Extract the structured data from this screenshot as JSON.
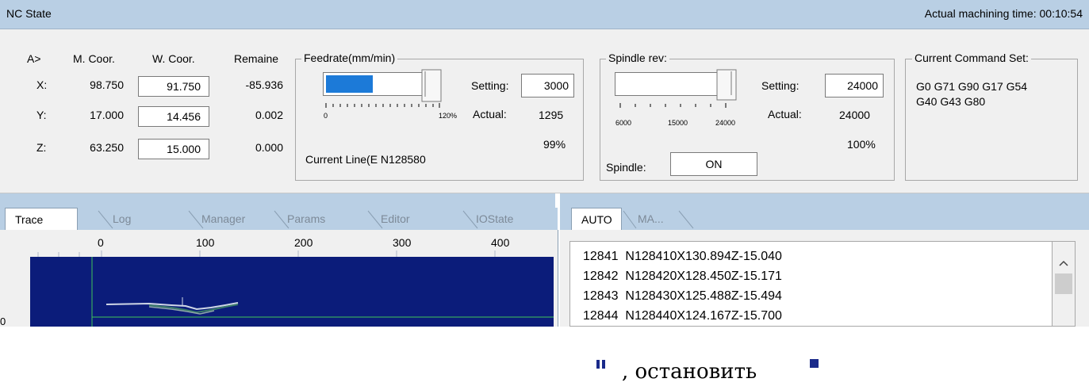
{
  "header": {
    "title": "NC State",
    "machining_time": "Actual machining time: 00:10:54"
  },
  "coordinates": {
    "headers": {
      "axis": "A>",
      "machine": "M. Coor.",
      "work": "W. Coor.",
      "remain": "Remaine"
    },
    "rows": [
      {
        "axis": "X:",
        "machine": "98.750",
        "work": "91.750",
        "remain": "-85.936"
      },
      {
        "axis": "Y:",
        "machine": "17.000",
        "work": "14.456",
        "remain": "0.002"
      },
      {
        "axis": "Z:",
        "machine": "63.250",
        "work": "15.000",
        "remain": "0.000"
      }
    ]
  },
  "feedrate": {
    "title": "Feedrate(mm/min)",
    "slider_min": "0",
    "slider_max": "120%",
    "fill_fraction": 0.45,
    "setting_label": "Setting:",
    "setting_value": "3000",
    "actual_label": "Actual:",
    "actual_value": "1295",
    "percent": "99%",
    "current_line": "Current Line(E N128580"
  },
  "spindle": {
    "title": "Spindle rev:",
    "tick_labels": [
      "6000",
      "15000",
      "24000"
    ],
    "setting_label": "Setting:",
    "setting_value": "24000",
    "actual_label": "Actual:",
    "actual_value": "24000",
    "percent": "100%",
    "status_label": "Spindle:",
    "status_value": "ON"
  },
  "command_set": {
    "title": "Current Command Set:",
    "line1": "G0 G71 G90 G17 G54",
    "line2": "G40 G43 G80"
  },
  "trace": {
    "tabs": [
      "Trace",
      "Log",
      "Manager",
      "Params",
      "Editor",
      "IOState"
    ],
    "active_tab": "Trace",
    "x_axis_labels": [
      "0",
      "100",
      "200",
      "300",
      "400"
    ],
    "y_axis_label": "0",
    "plot_color": "#0b1c7a"
  },
  "program": {
    "tabs": [
      "AUTO",
      "MA..."
    ],
    "active_tab": "AUTO",
    "lines": [
      {
        "num": "12841",
        "code": "N128410X130.894Z-15.040"
      },
      {
        "num": "12842",
        "code": "N128420X128.450Z-15.171"
      },
      {
        "num": "12843",
        "code": "N128430X125.488Z-15.494"
      },
      {
        "num": "12844",
        "code": "N128440X124.167Z-15.700"
      }
    ]
  },
  "footer": {
    "text": ", остановить",
    "pause_icon": "pause-icon",
    "stop_icon": "stop-icon"
  }
}
